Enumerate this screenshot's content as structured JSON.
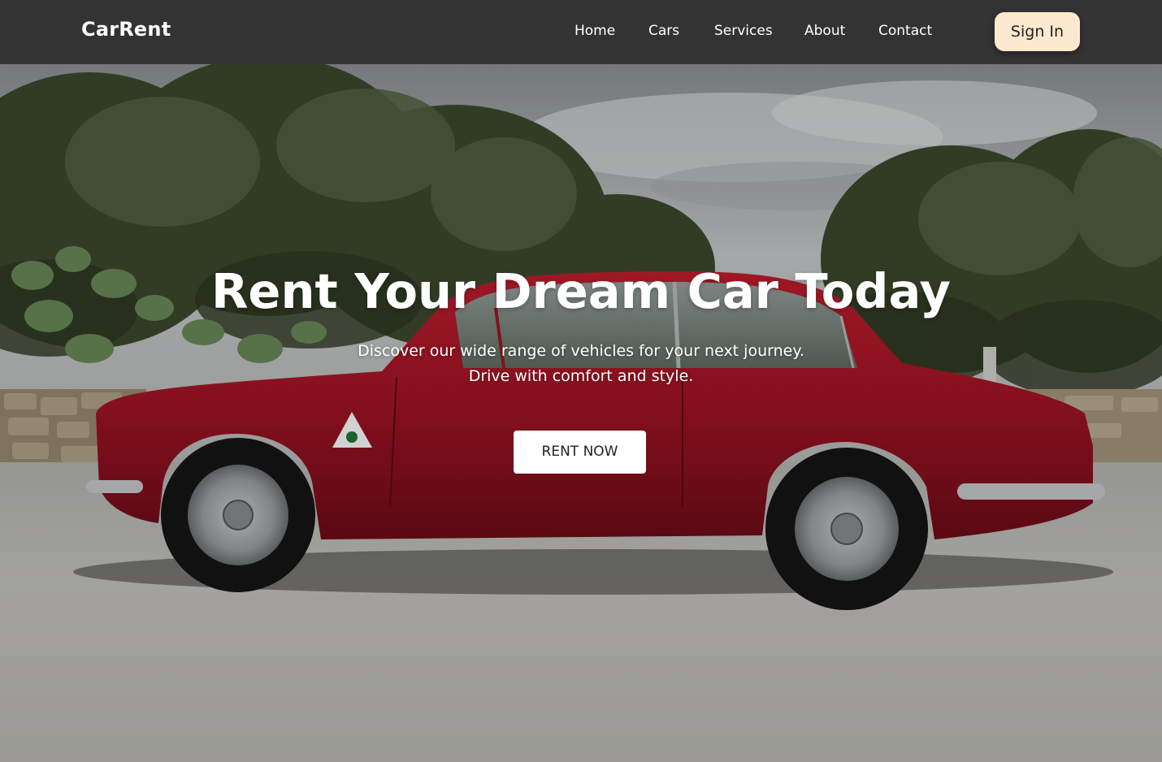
{
  "navbar": {
    "brand": "CarRent",
    "links": [
      "Home",
      "Cars",
      "Services",
      "About",
      "Contact"
    ],
    "signin_label": "Sign In"
  },
  "hero": {
    "title": "Rent Your Dream Car Today",
    "subtitle_line1": "Discover our wide range of vehicles for your next journey.",
    "subtitle_line2": "Drive with comfort and style.",
    "cta_label": "RENT NOW",
    "image": "red-classic-coupe-photo"
  },
  "colors": {
    "navbar_bg": "#333333",
    "signin_bg": "#fde9cf",
    "car_red": "#a31425",
    "text_white": "#ffffff"
  }
}
